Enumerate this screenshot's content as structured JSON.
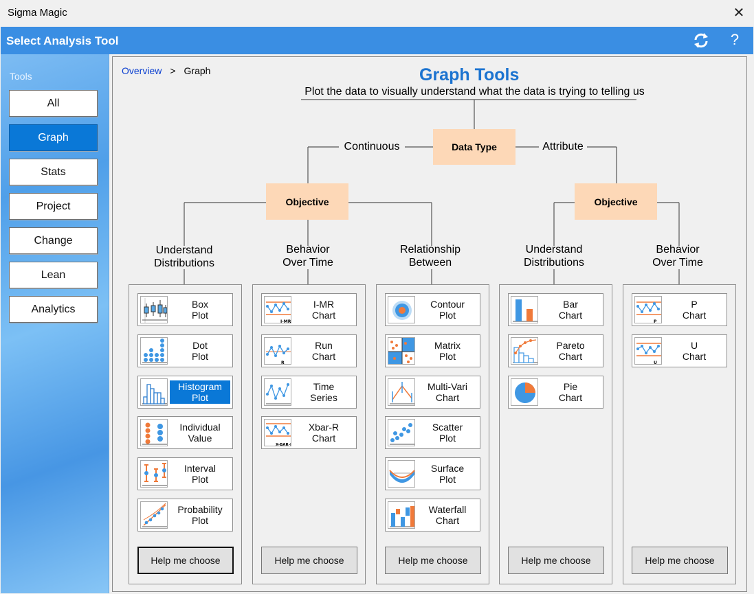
{
  "window": {
    "title": "Sigma Magic"
  },
  "header": {
    "title": "Select Analysis Tool"
  },
  "sidebar": {
    "label": "Tools",
    "items": [
      {
        "label": "All",
        "active": false
      },
      {
        "label": "Graph",
        "active": true
      },
      {
        "label": "Stats",
        "active": false
      },
      {
        "label": "Project",
        "active": false
      },
      {
        "label": "Change",
        "active": false
      },
      {
        "label": "Lean",
        "active": false
      },
      {
        "label": "Analytics",
        "active": false
      }
    ]
  },
  "breadcrumb": {
    "link": "Overview",
    "separator": ">",
    "current": "Graph"
  },
  "main": {
    "title": "Graph Tools",
    "subtitle": "Plot the data to visually understand what the data is trying to telling us"
  },
  "tree": {
    "root": "Data Type",
    "branch_continuous": "Continuous",
    "branch_attribute": "Attribute",
    "objective_left": "Objective",
    "objective_right": "Objective"
  },
  "categories": [
    {
      "label": "Understand\nDistributions",
      "tools": [
        {
          "label": "Box\nPlot",
          "icon": "box-plot-icon",
          "selected": false
        },
        {
          "label": "Dot\nPlot",
          "icon": "dot-plot-icon",
          "selected": false
        },
        {
          "label": "Histogram\nPlot",
          "icon": "histogram-icon",
          "selected": true
        },
        {
          "label": "Individual\nValue",
          "icon": "individual-value-icon",
          "selected": false
        },
        {
          "label": "Interval\nPlot",
          "icon": "interval-plot-icon",
          "selected": false
        },
        {
          "label": "Probability\nPlot",
          "icon": "probability-plot-icon",
          "selected": false
        }
      ],
      "help": "Help me choose"
    },
    {
      "label": "Behavior\nOver Time",
      "tools": [
        {
          "label": "I-MR\nChart",
          "icon": "imr-chart-icon",
          "selected": false
        },
        {
          "label": "Run\nChart",
          "icon": "run-chart-icon",
          "selected": false
        },
        {
          "label": "Time\nSeries",
          "icon": "time-series-icon",
          "selected": false
        },
        {
          "label": "Xbar-R\nChart",
          "icon": "xbar-r-chart-icon",
          "selected": false
        }
      ],
      "help": "Help me choose"
    },
    {
      "label": "Relationship\nBetween",
      "tools": [
        {
          "label": "Contour\nPlot",
          "icon": "contour-plot-icon",
          "selected": false
        },
        {
          "label": "Matrix\nPlot",
          "icon": "matrix-plot-icon",
          "selected": false
        },
        {
          "label": "Multi-Vari\nChart",
          "icon": "multi-vari-chart-icon",
          "selected": false
        },
        {
          "label": "Scatter\nPlot",
          "icon": "scatter-plot-icon",
          "selected": false
        },
        {
          "label": "Surface\nPlot",
          "icon": "surface-plot-icon",
          "selected": false
        },
        {
          "label": "Waterfall\nChart",
          "icon": "waterfall-chart-icon",
          "selected": false
        }
      ],
      "help": "Help me choose"
    },
    {
      "label": "Understand\nDistributions",
      "tools": [
        {
          "label": "Bar\nChart",
          "icon": "bar-chart-icon",
          "selected": false
        },
        {
          "label": "Pareto\nChart",
          "icon": "pareto-chart-icon",
          "selected": false
        },
        {
          "label": "Pie\nChart",
          "icon": "pie-chart-icon",
          "selected": false
        }
      ],
      "help": "Help me choose"
    },
    {
      "label": "Behavior\nOver Time",
      "tools": [
        {
          "label": "P\nChart",
          "icon": "p-chart-icon",
          "selected": false
        },
        {
          "label": "U\nChart",
          "icon": "u-chart-icon",
          "selected": false
        }
      ],
      "help": "Help me choose"
    }
  ],
  "colors": {
    "accent": "#3a8ee3",
    "node": "#fdd8b7",
    "selected": "#0a78d7",
    "title": "#1b73d0"
  }
}
